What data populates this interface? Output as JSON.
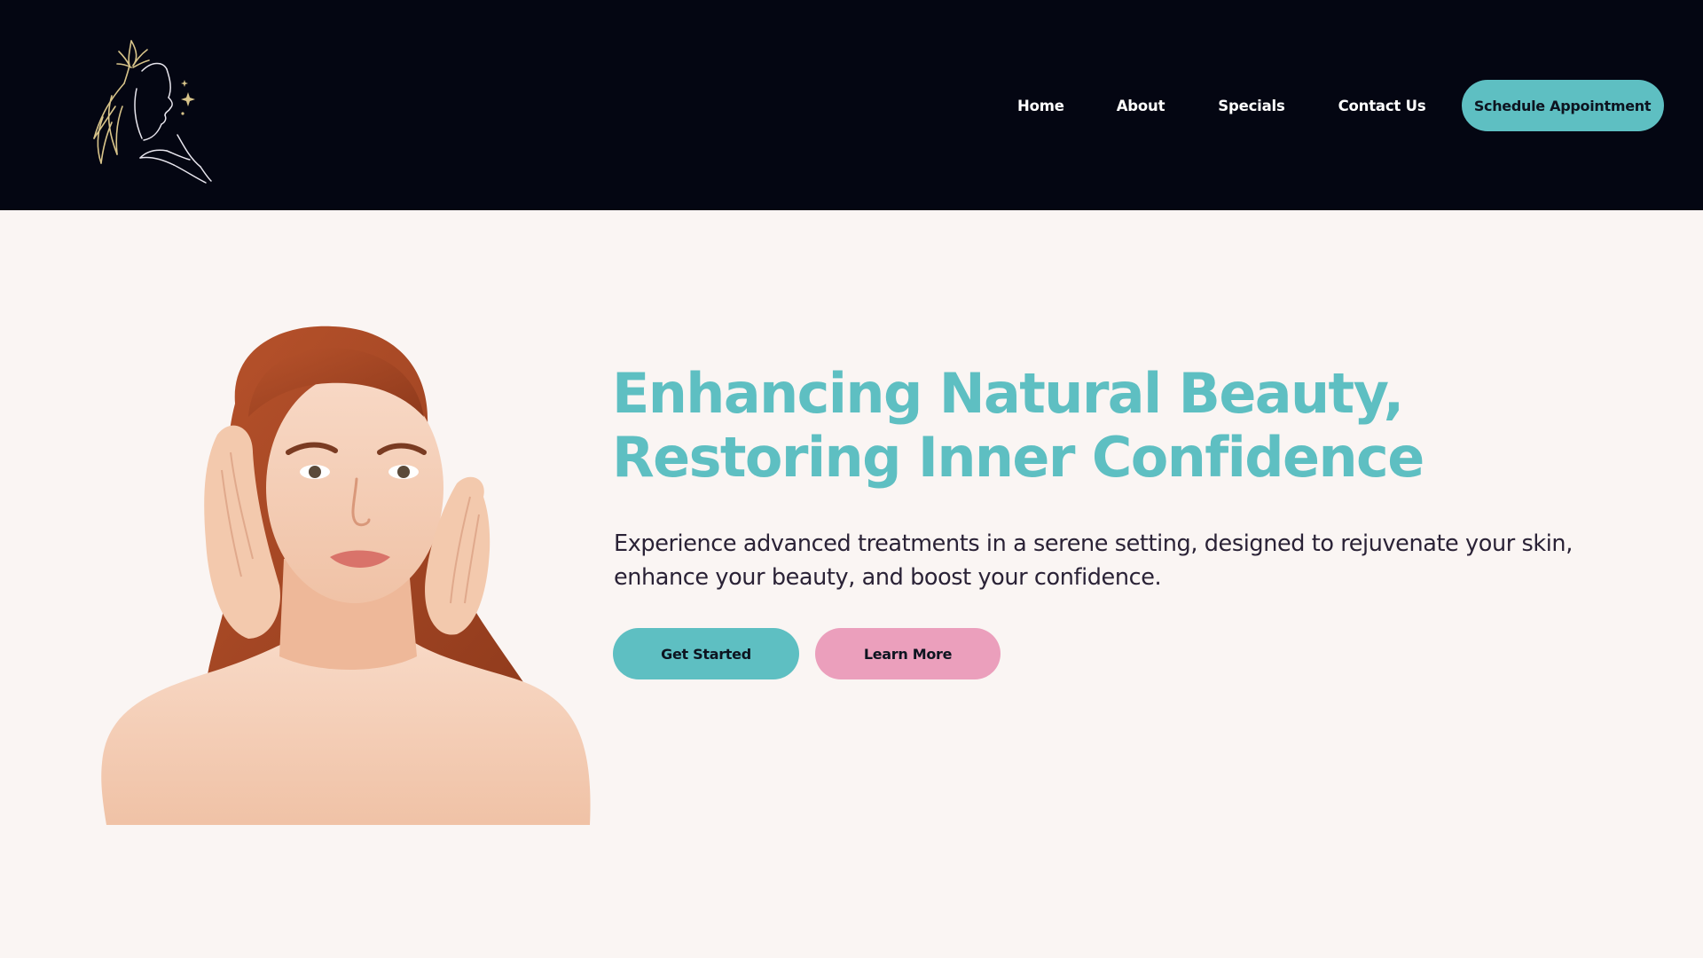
{
  "header": {
    "logo_icon": "woman-profile-lily-logo",
    "nav": [
      {
        "label": "Home"
      },
      {
        "label": "About"
      },
      {
        "label": "Specials"
      },
      {
        "label": "Contact Us"
      }
    ],
    "cta_label": "Schedule Appointment"
  },
  "hero": {
    "headline_line1": "Enhancing Natural Beauty,",
    "headline_line2": "Restoring Inner Confidence",
    "subtext": "Experience advanced treatments in a serene setting, designed to rejuvenate your skin, enhance your beauty, and boost your confidence.",
    "primary_button": "Get Started",
    "secondary_button": "Learn More",
    "image_icon": "woman-portrait-photo"
  },
  "colors": {
    "header_bg": "#040612",
    "page_bg": "#faf5f3",
    "accent_teal": "#5ebfc2",
    "accent_pink": "#eb9fbc",
    "logo_gold": "#d8c48a",
    "text_dark": "#2a2236"
  }
}
